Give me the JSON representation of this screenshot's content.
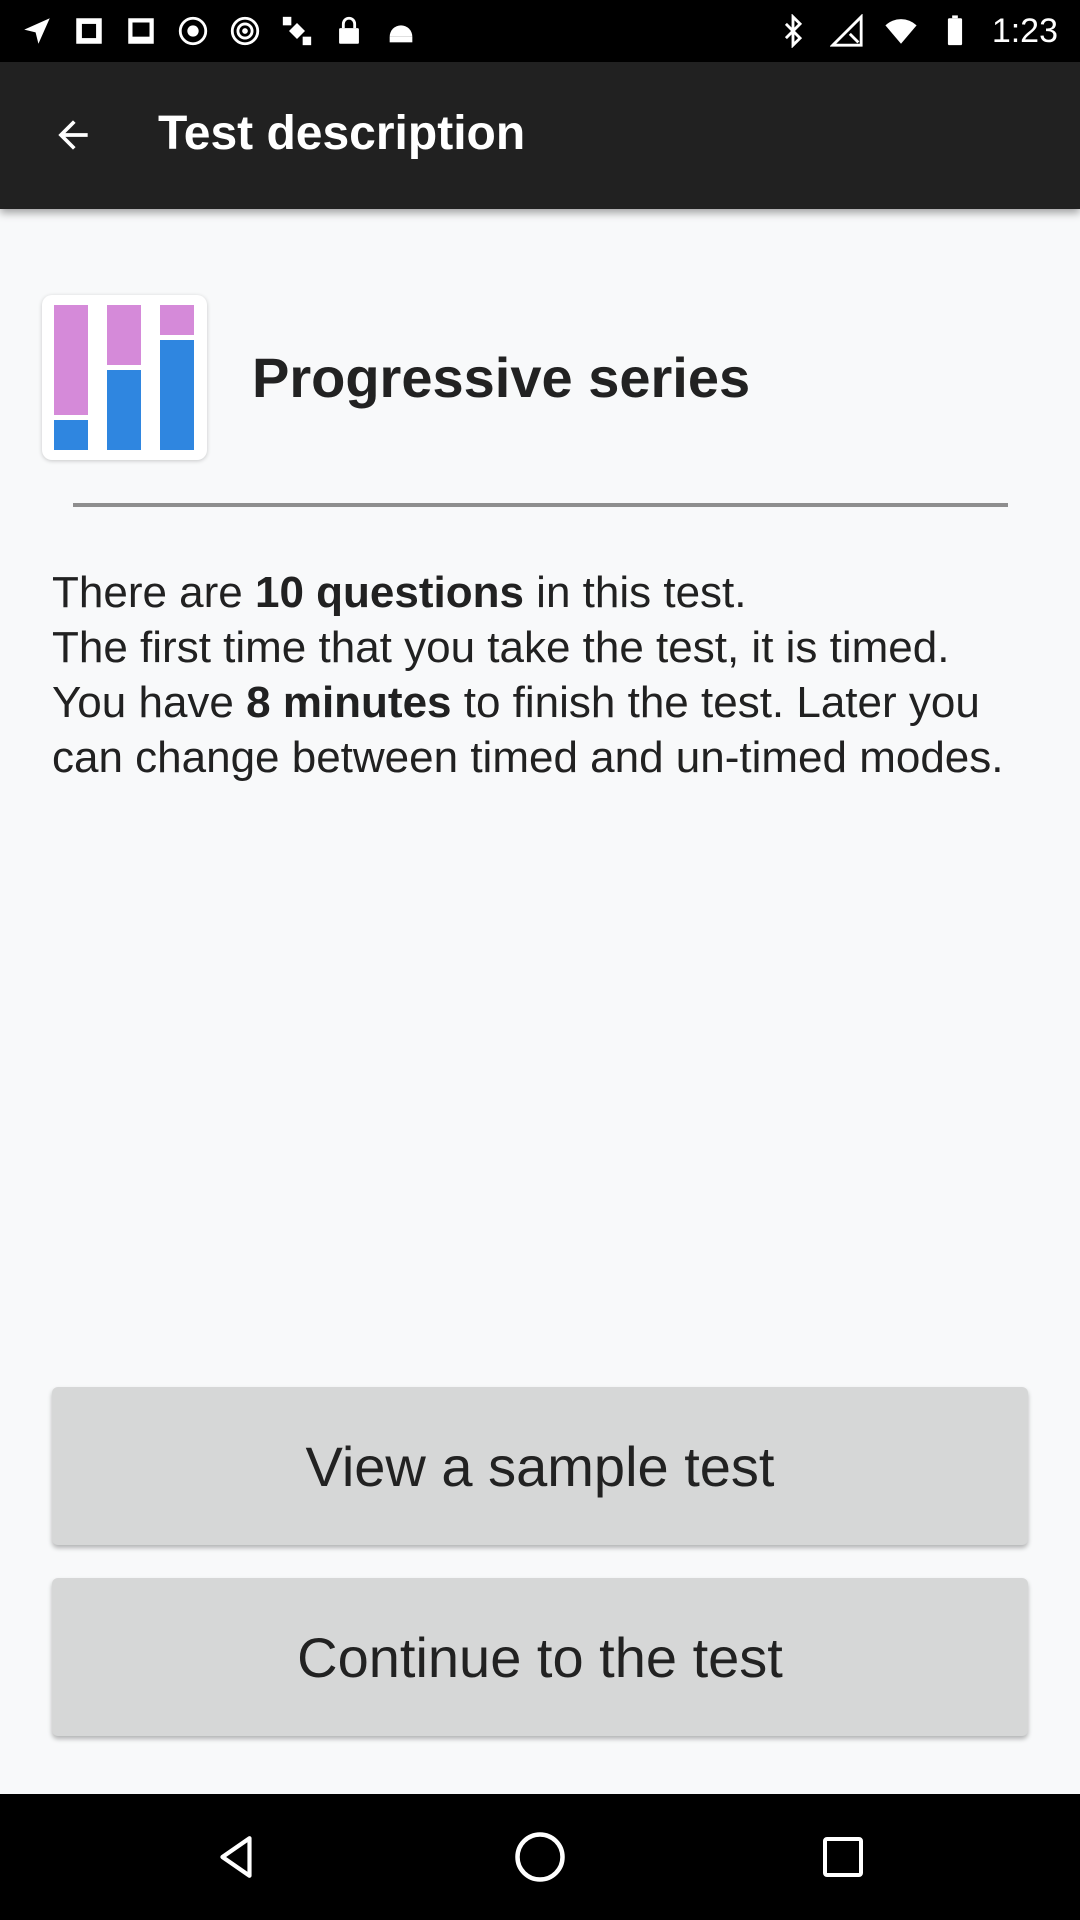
{
  "status_bar": {
    "time": "1:23",
    "left_icons": [
      "navigation-arrow-icon",
      "app-notification-icon",
      "image-notification-icon",
      "record-icon",
      "hotspot-icon",
      "satellite-fake-gps-icon",
      "lock-icon",
      "android-debug-icon"
    ],
    "right_icons": [
      "bluetooth-icon",
      "signal-off-icon",
      "wifi-icon",
      "battery-icon"
    ]
  },
  "app_bar": {
    "title": "Test description",
    "back_icon": "arrow-back-icon"
  },
  "test": {
    "name": "Progressive series",
    "logo_colors": {
      "pink": "#d58ad9",
      "blue": "#2f86e0"
    }
  },
  "description": {
    "line1_pre": "There are ",
    "line1_bold": "10 questions",
    "line1_post": " in this test.",
    "line2": "The first time that you take the test, it is timed.",
    "line3_pre": "You have ",
    "line3_bold": "8 minutes",
    "line3_post": " to finish the test. Later you can change between timed and un-timed modes."
  },
  "buttons": {
    "sample": "View a sample test",
    "continue": "Continue to the test"
  },
  "nav_bar": {
    "icons": [
      "nav-back-icon",
      "nav-home-icon",
      "nav-recent-apps-icon"
    ]
  }
}
